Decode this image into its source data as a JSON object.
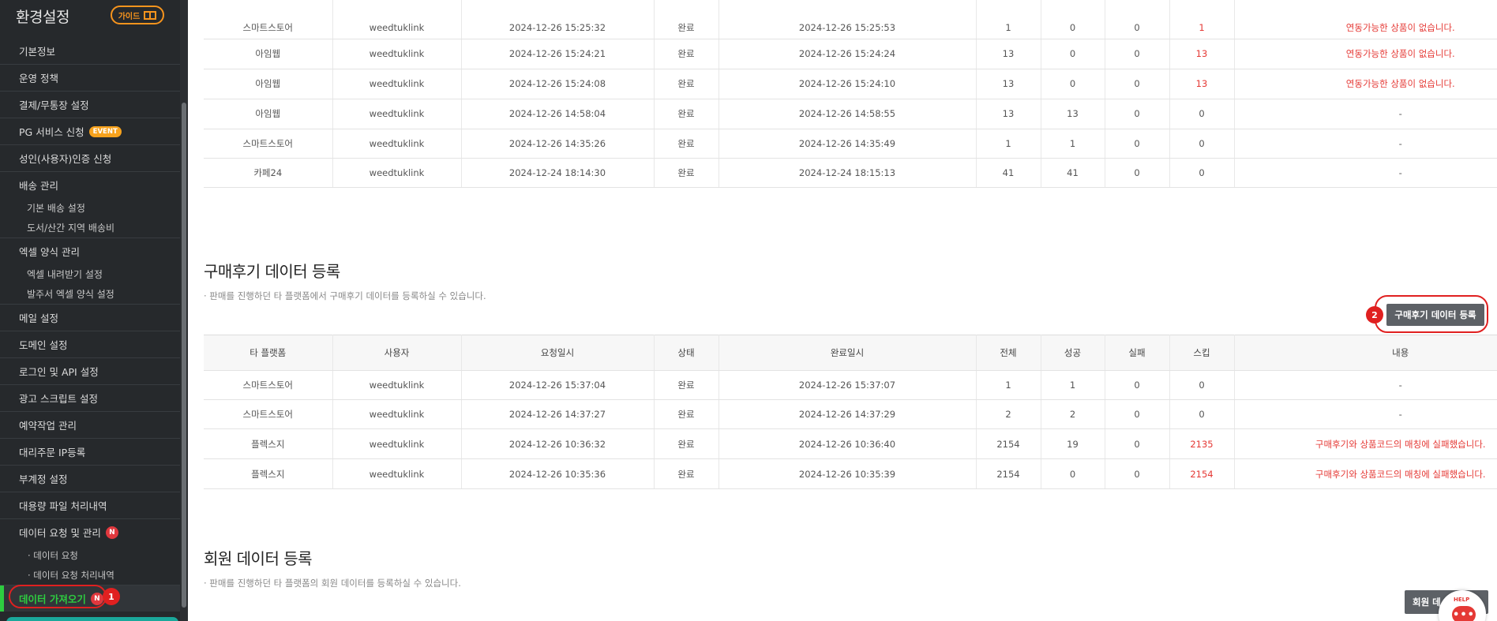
{
  "sidebar": {
    "title": "환경설정",
    "guide_label": "가이드",
    "items": [
      {
        "label": "기본정보"
      },
      {
        "label": "운영 정책"
      },
      {
        "label": "결제/무통장 설정"
      },
      {
        "label": "PG 서비스 신청",
        "badge": "EVENT"
      },
      {
        "label": "성인(사용자)인증 신청"
      },
      {
        "label": "배송 관리"
      },
      {
        "label": "기본 배송 설정"
      },
      {
        "label": "도서/산간 지역 배송비"
      },
      {
        "label": "엑셀 양식 관리"
      },
      {
        "label": "엑셀 내려받기 설정"
      },
      {
        "label": "발주서 엑셀 양식 설정"
      },
      {
        "label": "메일 설정"
      },
      {
        "label": "도메인 설정"
      },
      {
        "label": "로그인 및 API 설정"
      },
      {
        "label": "광고 스크립트 설정"
      },
      {
        "label": "예약작업 관리"
      },
      {
        "label": "대리주문 IP등록"
      },
      {
        "label": "부계정 설정"
      },
      {
        "label": "대용량 파일 처리내역"
      },
      {
        "label": "데이터 요청 및 관리",
        "badge": "N"
      },
      {
        "label": "· 데이터 요청"
      },
      {
        "label": "· 데이터 요청 처리내역"
      },
      {
        "label": "데이터 가져오기",
        "badge": "N"
      }
    ],
    "step1": "1"
  },
  "product_table": {
    "rows": [
      {
        "platform": "스마트스토어",
        "user": "weedtuklink",
        "requested": "2024-12-26 15:25:32",
        "status": "완료",
        "completed": "2024-12-26 15:25:53",
        "total": "1",
        "success": "0",
        "fail": "0",
        "skip": "1",
        "note": "연동가능한 상품이 없습니다.",
        "alert": true
      },
      {
        "platform": "아임웹",
        "user": "weedtuklink",
        "requested": "2024-12-26 15:24:21",
        "status": "완료",
        "completed": "2024-12-26 15:24:24",
        "total": "13",
        "success": "0",
        "fail": "0",
        "skip": "13",
        "note": "연동가능한 상품이 없습니다.",
        "alert": true
      },
      {
        "platform": "아임웹",
        "user": "weedtuklink",
        "requested": "2024-12-26 15:24:08",
        "status": "완료",
        "completed": "2024-12-26 15:24:10",
        "total": "13",
        "success": "0",
        "fail": "0",
        "skip": "13",
        "note": "연동가능한 상품이 없습니다.",
        "alert": true
      },
      {
        "platform": "아임웹",
        "user": "weedtuklink",
        "requested": "2024-12-26 14:58:04",
        "status": "완료",
        "completed": "2024-12-26 14:58:55",
        "total": "13",
        "success": "13",
        "fail": "0",
        "skip": "0",
        "note": "-",
        "alert": false
      },
      {
        "platform": "스마트스토어",
        "user": "weedtuklink",
        "requested": "2024-12-26 14:35:26",
        "status": "완료",
        "completed": "2024-12-26 14:35:49",
        "total": "1",
        "success": "1",
        "fail": "0",
        "skip": "0",
        "note": "-",
        "alert": false
      },
      {
        "platform": "카페24",
        "user": "weedtuklink",
        "requested": "2024-12-24 18:14:30",
        "status": "완료",
        "completed": "2024-12-24 18:15:13",
        "total": "41",
        "success": "41",
        "fail": "0",
        "skip": "0",
        "note": "-",
        "alert": false
      }
    ]
  },
  "review_section": {
    "title": "구매후기 데이터 등록",
    "desc": "· 판매를 진행하던 타 플랫폼에서 구매후기 데이터를 등록하실 수 있습니다.",
    "button": "구매후기 데이터 등록",
    "step2": "2",
    "headers": [
      "타 플랫폼",
      "사용자",
      "요청일시",
      "상태",
      "완료일시",
      "전체",
      "성공",
      "실패",
      "스킵",
      "내용"
    ],
    "rows": [
      {
        "platform": "스마트스토어",
        "user": "weedtuklink",
        "requested": "2024-12-26 15:37:04",
        "status": "완료",
        "completed": "2024-12-26 15:37:07",
        "total": "1",
        "success": "1",
        "fail": "0",
        "skip": "0",
        "note": "-",
        "alert": false
      },
      {
        "platform": "스마트스토어",
        "user": "weedtuklink",
        "requested": "2024-12-26 14:37:27",
        "status": "완료",
        "completed": "2024-12-26 14:37:29",
        "total": "2",
        "success": "2",
        "fail": "0",
        "skip": "0",
        "note": "-",
        "alert": false
      },
      {
        "platform": "플렉스지",
        "user": "weedtuklink",
        "requested": "2024-12-26 10:36:32",
        "status": "완료",
        "completed": "2024-12-26 10:36:40",
        "total": "2154",
        "success": "19",
        "fail": "0",
        "skip": "2135",
        "note": "구매후기와 상품코드의 매칭에 실패했습니다.",
        "alert": true
      },
      {
        "platform": "플렉스지",
        "user": "weedtuklink",
        "requested": "2024-12-26 10:35:36",
        "status": "완료",
        "completed": "2024-12-26 10:35:39",
        "total": "2154",
        "success": "0",
        "fail": "0",
        "skip": "2154",
        "note": "구매후기와 상품코드의 매칭에 실패했습니다.",
        "alert": true
      }
    ]
  },
  "member_section": {
    "title": "회원 데이터 등록",
    "desc": "· 판매를 진행하던 타 플랫폼의 회원 데이터를 등록하실 수 있습니다.",
    "button": "회원 데"
  },
  "help": {
    "label": "HELP",
    "dots": "•••"
  },
  "colors": {
    "sidebar_bg": "#26292c",
    "accent_green": "#2ecc40",
    "alert_red": "#e53935",
    "guide_orange": "#f7941d",
    "button_dark": "#5d6166"
  }
}
